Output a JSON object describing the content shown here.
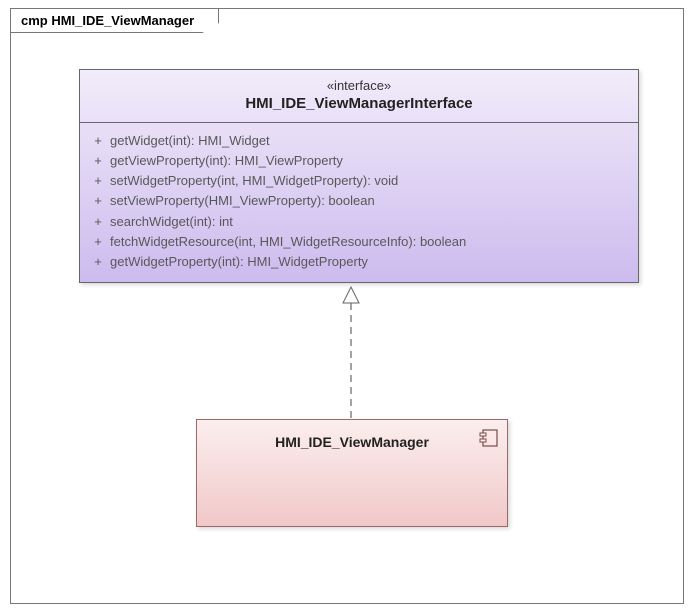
{
  "frame": {
    "label": "cmp HMI_IDE_ViewManager"
  },
  "interface": {
    "stereotype": "«interface»",
    "name": "HMI_IDE_ViewManagerInterface",
    "operations": [
      {
        "vis": "+",
        "sig": "getWidget(int): HMI_Widget"
      },
      {
        "vis": "+",
        "sig": "getViewProperty(int): HMI_ViewProperty"
      },
      {
        "vis": "+",
        "sig": "setWidgetProperty(int, HMI_WidgetProperty): void"
      },
      {
        "vis": "+",
        "sig": "setViewProperty(HMI_ViewProperty): boolean"
      },
      {
        "vis": "+",
        "sig": "searchWidget(int): int"
      },
      {
        "vis": "+",
        "sig": "fetchWidgetResource(int, HMI_WidgetResourceInfo): boolean"
      },
      {
        "vis": "+",
        "sig": "getWidgetProperty(int): HMI_WidgetProperty"
      }
    ]
  },
  "component": {
    "name": "HMI_IDE_ViewManager"
  },
  "chart_data": {
    "type": "uml-component-diagram",
    "frame": "cmp HMI_IDE_ViewManager",
    "elements": [
      {
        "id": "iface",
        "kind": "interface",
        "name": "HMI_IDE_ViewManagerInterface",
        "operations": [
          "+ getWidget(int): HMI_Widget",
          "+ getViewProperty(int): HMI_ViewProperty",
          "+ setWidgetProperty(int, HMI_WidgetProperty): void",
          "+ setViewProperty(HMI_ViewProperty): boolean",
          "+ searchWidget(int): int",
          "+ fetchWidgetResource(int, HMI_WidgetResourceInfo): boolean",
          "+ getWidgetProperty(int): HMI_WidgetProperty"
        ]
      },
      {
        "id": "comp",
        "kind": "component",
        "name": "HMI_IDE_ViewManager"
      }
    ],
    "relationships": [
      {
        "from": "comp",
        "to": "iface",
        "type": "realization",
        "style": "dashed-open-triangle"
      }
    ]
  }
}
